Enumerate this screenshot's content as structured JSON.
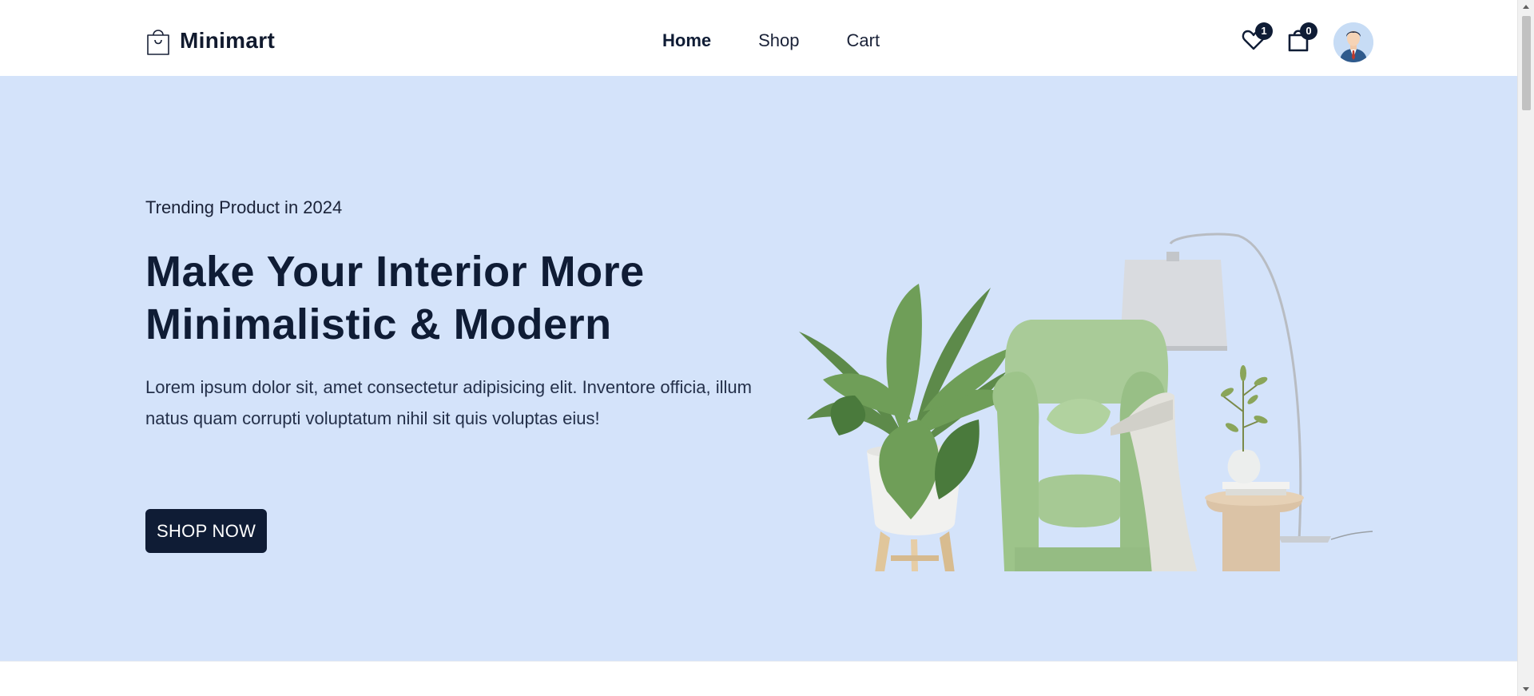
{
  "navbar": {
    "brand": {
      "name": "Minimart",
      "icon": "shopping-bag-icon"
    },
    "links": [
      {
        "label": "Home",
        "active": true
      },
      {
        "label": "Shop",
        "active": false
      },
      {
        "label": "Cart",
        "active": false
      }
    ],
    "wishlist": {
      "icon": "heart-icon",
      "count": "1"
    },
    "cart": {
      "icon": "shopping-bag-icon",
      "count": "0"
    },
    "avatar": {
      "icon": "user-avatar"
    }
  },
  "hero": {
    "eyebrow": "Trending Product in 2024",
    "headline_line1": "Make Your Interior More",
    "headline_line2": "Minimalistic & Modern",
    "body": "Lorem ipsum dolor sit, amet consectetur adipisicing elit. Inventore officia, illum natus quam corrupti voluptatum nihil sit quis voluptas eius!",
    "cta_label": "SHOP NOW",
    "image": "armchair-plant-lamp-illustration"
  },
  "colors": {
    "hero_bg": "#d4e3fa",
    "primary": "#0f1c35",
    "armchair": "#9dc48a"
  }
}
